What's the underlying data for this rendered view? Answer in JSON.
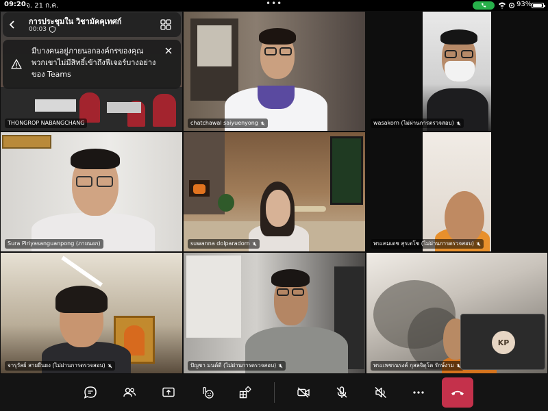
{
  "status_bar": {
    "time": "09:20",
    "date": "จ. 21 ก.ค.",
    "battery": "93%",
    "battery_fraction": 0.93
  },
  "meeting": {
    "title": "การประชุมใน วิชามัคคุเทศก์",
    "elapsed": "00:03"
  },
  "banner": {
    "message": "มีบางคนอยู่ภายนอกองค์กรของคุณ พวกเขาไม่มีสิทธิ์เข้าถึงฟีเจอร์บางอย่างของ Teams"
  },
  "participants": [
    {
      "name": "THONGROP NABANGCHANG",
      "muted": false
    },
    {
      "name": "chatchawal saiyuenyong",
      "muted": true
    },
    {
      "name": "wasakorn (ไม่ผ่านการตรวจสอบ)",
      "muted": true
    },
    {
      "name": "Sura Piriyasanguanpong (ภายนอก)",
      "muted": false
    },
    {
      "name": "suwanna dolparadorn",
      "muted": true
    },
    {
      "name": "พระคมเดช สุรเตโช (ไม่ผ่านการตรวจสอบ)",
      "muted": true
    },
    {
      "name": "จารุวัลย์ สายยืนยง (ไม่ผ่านการตรวจสอบ)",
      "muted": true
    },
    {
      "name": "ปัญชา มนต์ดี (ไม่ผ่านการตรวจสอบ)",
      "muted": true
    },
    {
      "name": "พระเพชรนรงค์ กุสลจิตฺโต รักษ์งาม",
      "muted": true
    }
  ],
  "self": {
    "initials": "KP"
  },
  "toolbar": [
    "chat-icon",
    "people-icon",
    "share-screen-icon",
    "reactions-icon",
    "apps-icon",
    "camera-off-icon",
    "mic-off-icon",
    "speaker-off-icon",
    "more-icon",
    "hang-up-icon"
  ],
  "colors": {
    "hangup": "#c4314b",
    "call_active": "#27b04a"
  }
}
